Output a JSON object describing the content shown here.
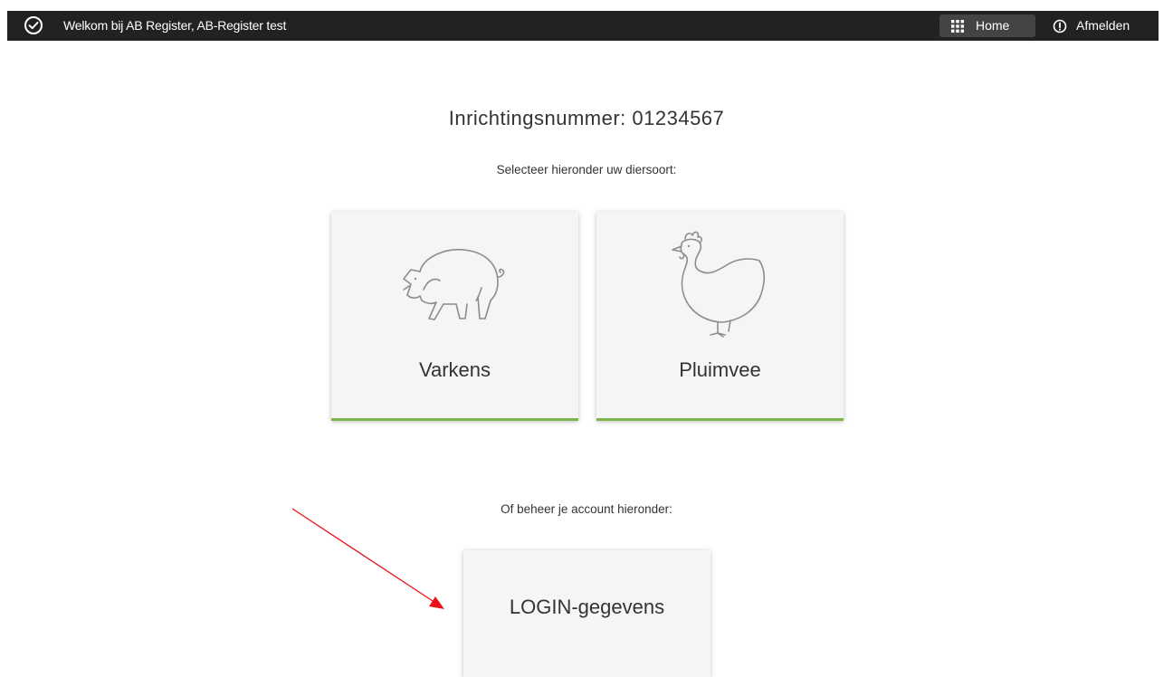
{
  "header": {
    "welcome_text": "Welkom bij AB Register, AB-Register test",
    "home_label": "Home",
    "logout_label": "Afmelden"
  },
  "main": {
    "title": "Inrichtingsnummer: 01234567",
    "select_prompt": "Selecteer hieronder uw diersoort:",
    "animal_cards": [
      {
        "label": "Varkens",
        "icon": "pig-icon"
      },
      {
        "label": "Pluimvee",
        "icon": "chicken-icon"
      }
    ],
    "account_prompt": "Of beheer je account hieronder:",
    "account_card": {
      "label": "LOGIN-gegevens"
    }
  },
  "colors": {
    "topbar": "#222222",
    "home_button": "#444444",
    "card_background": "#f5f5f5",
    "card_accent": "#7ab648",
    "annotation_arrow": "#e8141b"
  }
}
